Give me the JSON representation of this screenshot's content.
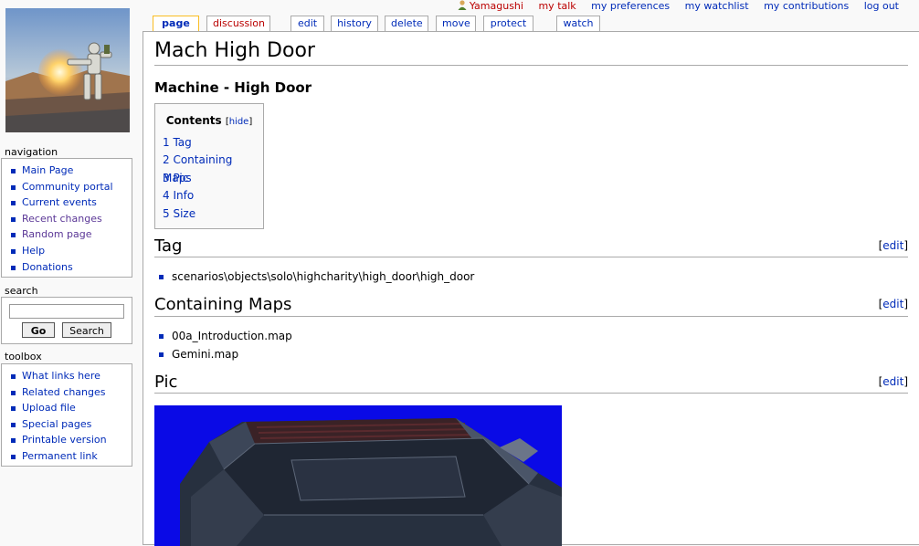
{
  "personal": {
    "user": "Yamagushi",
    "links": [
      "my talk",
      "my preferences",
      "my watchlist",
      "my contributions",
      "log out"
    ]
  },
  "tabs": {
    "page": "page",
    "discussion": "discussion",
    "edit": "edit",
    "history": "history",
    "delete": "delete",
    "move": "move",
    "protect": "protect",
    "watch": "watch"
  },
  "navigation": {
    "heading": "navigation",
    "items": [
      "Main Page",
      "Community portal",
      "Current events",
      "Recent changes",
      "Random page",
      "Help",
      "Donations"
    ]
  },
  "search": {
    "heading": "search",
    "go": "Go",
    "search": "Search",
    "value": ""
  },
  "toolbox": {
    "heading": "toolbox",
    "items": [
      "What links here",
      "Related changes",
      "Upload file",
      "Special pages",
      "Printable version",
      "Permanent link"
    ]
  },
  "article": {
    "title": "Mach High Door",
    "subtitle": "Machine - High Door",
    "toc": {
      "title": "Contents",
      "hide": "hide",
      "items": [
        "1 Tag",
        "2 Containing Maps",
        "3 Pic",
        "4 Info",
        "5 Size"
      ]
    },
    "edit_label": "edit",
    "sections": {
      "tag": {
        "heading": "Tag",
        "items": [
          "scenarios\\objects\\solo\\highcharity\\high_door\\high_door"
        ]
      },
      "maps": {
        "heading": "Containing Maps",
        "items": [
          "00a_Introduction.map",
          "Gemini.map"
        ]
      },
      "pic": {
        "heading": "Pic"
      }
    }
  },
  "colors": {
    "link": "#002bb8",
    "new_link": "#ba0000",
    "visited": "#5a3696",
    "pic_background": "#0a0ae6"
  }
}
